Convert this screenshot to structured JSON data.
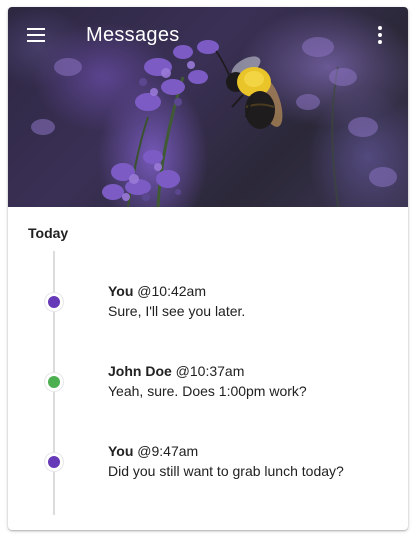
{
  "app": {
    "title": "Messages",
    "menu_icon": "menu-icon",
    "more_icon": "more-vert-icon"
  },
  "hero_image": {
    "subject": "bee on lavender flowers"
  },
  "section": {
    "label": "Today"
  },
  "messages": [
    {
      "author": "You",
      "time": "@10:42am",
      "text": "Sure, I'll see you later.",
      "dot_color": "#673ab7"
    },
    {
      "author": "John Doe",
      "time": "@10:37am",
      "text": "Yeah, sure. Does 1:00pm work?",
      "dot_color": "#4caf50"
    },
    {
      "author": "You",
      "time": "@9:47am",
      "text": "Did you still want to grab lunch today?",
      "dot_color": "#673ab7"
    }
  ],
  "colors": {
    "accent_purple": "#673ab7",
    "accent_green": "#4caf50",
    "timeline_line": "#dcdcdc"
  }
}
